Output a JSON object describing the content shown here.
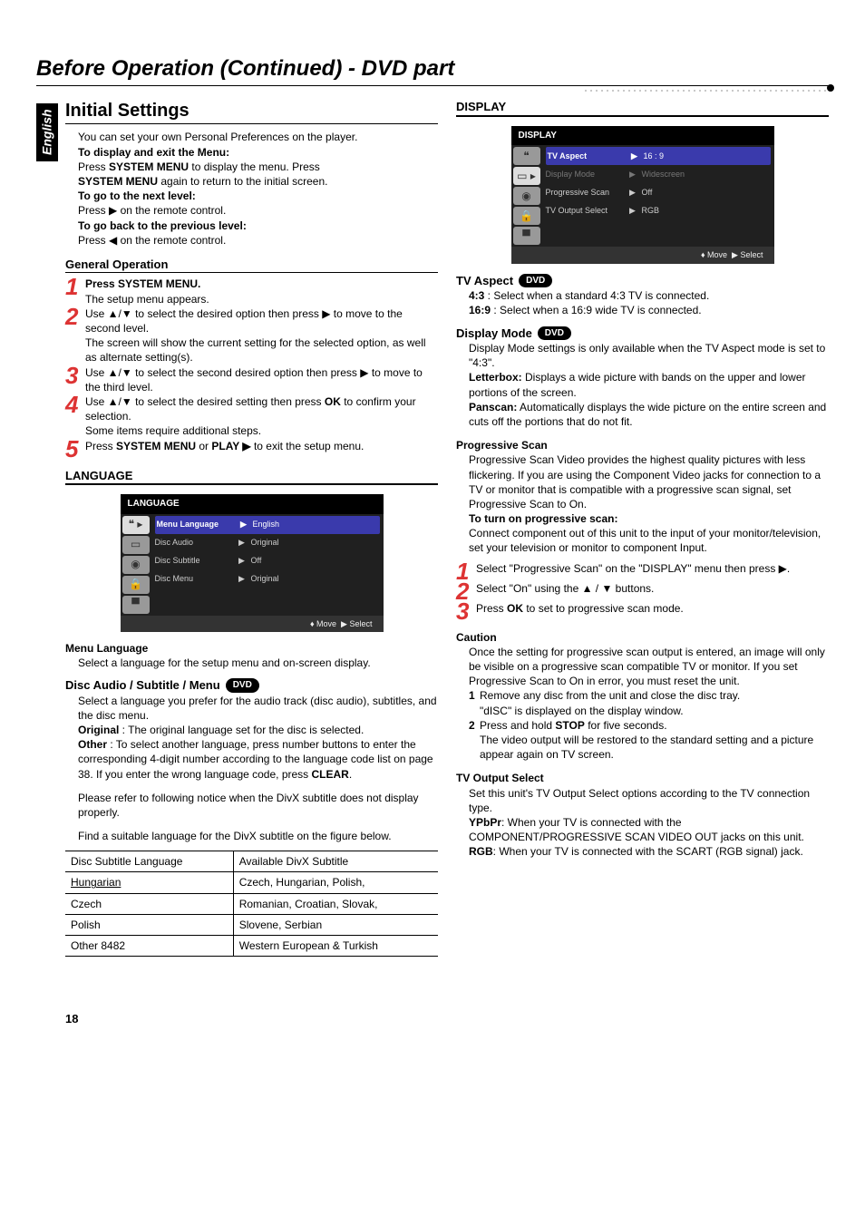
{
  "sidebar_label": "English",
  "chapter_title": "Before Operation (Continued) - DVD part",
  "section_title": "Initial Settings",
  "intro": {
    "p1": "You can set your own Personal Preferences on the player.",
    "p2": "To display and exit the Menu:",
    "p3a": "Press ",
    "p3b": "SYSTEM MENU",
    "p3c": " to display the menu. Press",
    "p4a": "SYSTEM MENU",
    "p4b": " again to return to the initial screen.",
    "p5": "To go to the next level:",
    "p6": "Press ▶ on the remote control.",
    "p7": "To go back to the previous level:",
    "p8": "Press ◀ on the remote control."
  },
  "general_operation_head": "General Operation",
  "steps": {
    "s1_a": "Press SYSTEM MENU.",
    "s1_b": "The setup menu appears.",
    "s2_a": "Use ▲/▼ to select the desired option then press ▶ to move to the second level.",
    "s2_b": "The screen will show the current setting for the selected option, as well as alternate setting(s).",
    "s3": "Use ▲/▼ to select the second desired option then press ▶ to move to the third level.",
    "s4_a": "Use ▲/▼ to select the desired setting then press ",
    "s4_ok": "OK",
    "s4_b": " to confirm your selection.",
    "s4_c": "Some items require additional steps.",
    "s5_a": "Press ",
    "s5_b": "SYSTEM MENU",
    "s5_c": " or ",
    "s5_d": "PLAY ▶",
    "s5_e": " to exit the setup menu."
  },
  "language_head": "LANGUAGE",
  "lang_menu": {
    "title": "LANGUAGE",
    "rows": [
      {
        "lbl": "Menu Language",
        "val": "English",
        "hl": true
      },
      {
        "lbl": "Disc Audio",
        "val": "Original"
      },
      {
        "lbl": "Disc Subtitle",
        "val": "Off"
      },
      {
        "lbl": "Disc Menu",
        "val": "Original"
      }
    ],
    "foot_move": "Move",
    "foot_select": "Select"
  },
  "menu_language_head": "Menu Language",
  "menu_language_p": "Select a language for the setup menu and on-screen display.",
  "disc_audio_head": "Disc Audio / Subtitle / Menu",
  "disc_audio_p1": "Select a language you prefer for the audio track (disc audio), subtitles, and the disc menu.",
  "original_lbl": "Original",
  "original_p": " : The original language set for the disc is selected.",
  "other_lbl": "Other",
  "other_p": " : To select another language, press number buttons to enter the corresponding 4-digit number according to the language code list on page 38. If you enter the wrong language code, press ",
  "clear_lbl": "CLEAR",
  "divx_notice": "Please refer to following notice when the DivX subtitle does not display properly.",
  "divx_find": "Find a suitable language for the DivX subtitle on the figure below.",
  "table": {
    "h1": "Disc Subtitle Language",
    "h2": "Available DivX Subtitle",
    "rows": [
      {
        "a": "Hungarian",
        "b": "Czech, Hungarian, Polish,"
      },
      {
        "a": "Czech",
        "b": "Romanian, Croatian, Slovak,"
      },
      {
        "a": "Polish",
        "b": "Slovene, Serbian"
      },
      {
        "a": "Other 8482",
        "b": "Western European & Turkish"
      }
    ]
  },
  "display_head": "DISPLAY",
  "display_menu": {
    "title": "DISPLAY",
    "rows": [
      {
        "lbl": "TV Aspect",
        "val": "16 : 9",
        "hl": true
      },
      {
        "lbl": "Display Mode",
        "val": "Widescreen",
        "dim": true
      },
      {
        "lbl": "Progressive Scan",
        "val": "Off"
      },
      {
        "lbl": "TV Output Select",
        "val": "RGB"
      }
    ],
    "foot_move": "Move",
    "foot_select": "Select"
  },
  "tvaspect_head": "TV Aspect",
  "tvaspect_43": "4:3",
  "tvaspect_43_p": " : Select when a standard 4:3 TV is connected.",
  "tvaspect_169": "16:9",
  "tvaspect_169_p": " : Select when a 16:9 wide TV is connected.",
  "displaymode_head": "Display Mode",
  "displaymode_p": "Display Mode settings is only available when the TV Aspect mode is set to \"4:3\".",
  "letterbox_lbl": "Letterbox:",
  "letterbox_p": " Displays a wide picture with bands on the upper and lower portions of the screen.",
  "panscan_lbl": "Panscan:",
  "panscan_p": " Automatically displays the wide picture on the entire screen and cuts off the portions that do not fit.",
  "progscan_head": "Progressive Scan",
  "progscan_p1": "Progressive Scan Video provides the highest quality pictures with less flickering. If you are using the Component Video jacks for connection to a TV or monitor that is compatible with a progressive scan signal, set Progressive Scan to On.",
  "progscan_turn": "To turn on progressive scan:",
  "progscan_p2": "Connect component out of this unit to the input of your monitor/television, set your television or monitor to component Input.",
  "psteps": {
    "s1": "Select \"Progressive Scan\" on the \"DISPLAY\" menu then press ▶.",
    "s2": "Select \"On\" using the ▲ / ▼ buttons.",
    "s3_a": "Press ",
    "s3_ok": "OK",
    "s3_b": " to set to progressive scan mode."
  },
  "caution_head": "Caution",
  "caution_p": "Once the setting for progressive scan output is entered, an image will only be visible on a progressive scan compatible TV or monitor. If you set Progressive Scan to On in error, you must reset the unit.",
  "caution_1a": "Remove any disc from the unit and close the disc tray.",
  "caution_1b": "\"dISC\" is displayed on the display window.",
  "caution_2a": "Press and hold ",
  "caution_2stop": "STOP",
  "caution_2b": " for five seconds.",
  "caution_2c": "The video output will be restored to the standard setting and a picture appear again on TV screen.",
  "tvout_head": "TV Output Select",
  "tvout_p": "Set this unit's TV Output Select options according to the TV connection type.",
  "ypbpr_lbl": "YPbPr",
  "ypbpr_p": ": When your TV is connected with the COMPONENT/PROGRESSIVE SCAN VIDEO OUT jacks on this unit.",
  "rgb_lbl": "RGB",
  "rgb_p": ": When your TV is connected with the SCART (RGB signal) jack.",
  "dvd_pill": "DVD",
  "page_number": "18"
}
